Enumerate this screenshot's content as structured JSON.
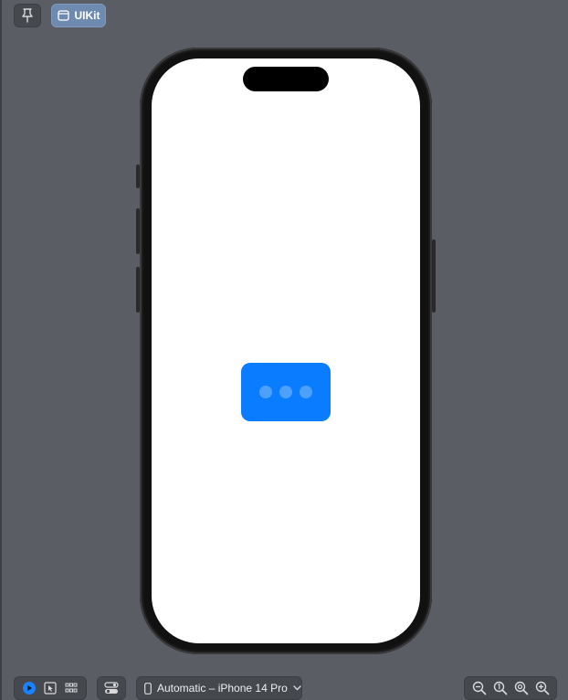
{
  "toolbar": {
    "pin": {
      "icon": "pin-icon"
    },
    "uikit": {
      "label": "UIKit",
      "icon": "window-icon"
    }
  },
  "preview": {
    "device": "iPhone 14 Pro",
    "bubble_color": "#0a7cff",
    "typing_dots": 3
  },
  "bottom_bar": {
    "modes": [
      "live-mode-icon",
      "select-mode-icon",
      "variants-grid-icon"
    ],
    "active_mode": "live",
    "settings_icon": "device-settings-icon",
    "device_selector": {
      "label": "Automatic – iPhone 14 Pro",
      "icon": "iphone-icon"
    },
    "zoom": [
      "zoom-out-icon",
      "zoom-actual-icon",
      "zoom-fit-icon",
      "zoom-in-icon"
    ]
  }
}
